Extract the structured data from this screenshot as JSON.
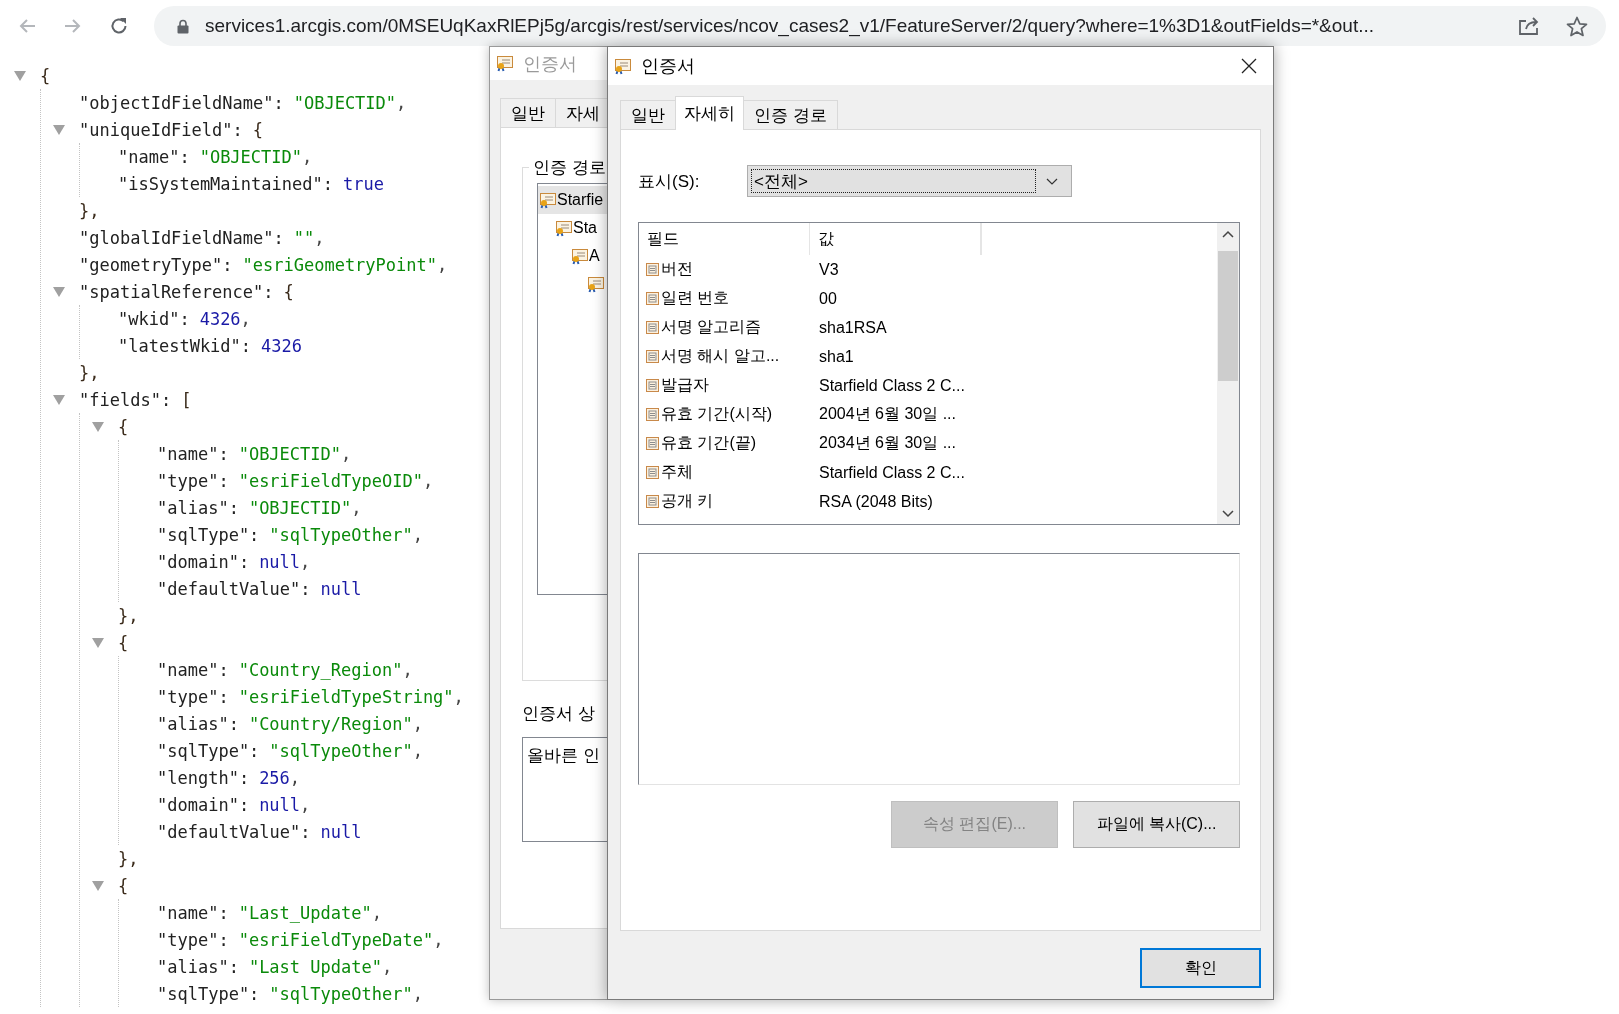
{
  "browser": {
    "nav": [
      {
        "kind": "back",
        "disabled": true
      },
      {
        "kind": "forward",
        "disabled": true
      },
      {
        "kind": "reload",
        "disabled": false
      }
    ],
    "url": "services1.arcgis.com/0MSEUqKaxRlEPj5g/arcgis/rest/services/ncov_cases2_v1/FeatureServer/2/query?where=1%3D1&outFields=*&out..."
  },
  "json_view": {
    "open": "{",
    "expanded": true,
    "children": [
      {
        "key": "\"objectIdFieldName\":",
        "value": "\"OBJECTID\"",
        "kind": "string",
        "end": ","
      },
      {
        "key": "\"uniqueIdField\":",
        "open": "{",
        "expanded": true,
        "close": "},",
        "children": [
          {
            "key": "\"name\":",
            "value": "\"OBJECTID\"",
            "kind": "string",
            "end": ","
          },
          {
            "key": "\"isSystemMaintained\":",
            "value": "true",
            "kind": "literal"
          }
        ]
      },
      {
        "key": "\"globalIdFieldName\":",
        "value": "\"\"",
        "kind": "string",
        "end": ","
      },
      {
        "key": "\"geometryType\":",
        "value": "\"esriGeometryPoint\"",
        "kind": "string",
        "end": ","
      },
      {
        "key": "\"spatialReference\":",
        "open": "{",
        "expanded": true,
        "close": "},",
        "children": [
          {
            "key": "\"wkid\":",
            "value": "4326",
            "kind": "number",
            "end": ","
          },
          {
            "key": "\"latestWkid\":",
            "value": "4326",
            "kind": "number"
          }
        ]
      },
      {
        "key": "\"fields\":",
        "open": "[",
        "expanded": true,
        "children": [
          {
            "open": "{",
            "expanded": true,
            "close": "},",
            "children": [
              {
                "key": "\"name\":",
                "value": "\"OBJECTID\"",
                "kind": "string",
                "end": ","
              },
              {
                "key": "\"type\":",
                "value": "\"esriFieldTypeOID\"",
                "kind": "string",
                "end": ","
              },
              {
                "key": "\"alias\":",
                "value": "\"OBJECTID\"",
                "kind": "string",
                "end": ","
              },
              {
                "key": "\"sqlType\":",
                "value": "\"sqlTypeOther\"",
                "kind": "string",
                "end": ","
              },
              {
                "key": "\"domain\":",
                "value": "null",
                "kind": "literal",
                "end": ","
              },
              {
                "key": "\"defaultValue\":",
                "value": "null",
                "kind": "literal"
              }
            ]
          },
          {
            "open": "{",
            "expanded": true,
            "close": "},",
            "children": [
              {
                "key": "\"name\":",
                "value": "\"Country_Region\"",
                "kind": "string",
                "end": ","
              },
              {
                "key": "\"type\":",
                "value": "\"esriFieldTypeString\"",
                "kind": "string",
                "end": ","
              },
              {
                "key": "\"alias\":",
                "value": "\"Country/Region\"",
                "kind": "string",
                "end": ","
              },
              {
                "key": "\"sqlType\":",
                "value": "\"sqlTypeOther\"",
                "kind": "string",
                "end": ","
              },
              {
                "key": "\"length\":",
                "value": "256",
                "kind": "number",
                "end": ","
              },
              {
                "key": "\"domain\":",
                "value": "null",
                "kind": "literal",
                "end": ","
              },
              {
                "key": "\"defaultValue\":",
                "value": "null",
                "kind": "literal"
              }
            ]
          },
          {
            "open": "{",
            "expanded": true,
            "children": [
              {
                "key": "\"name\":",
                "value": "\"Last_Update\"",
                "kind": "string",
                "end": ","
              },
              {
                "key": "\"type\":",
                "value": "\"esriFieldTypeDate\"",
                "kind": "string",
                "end": ","
              },
              {
                "key": "\"alias\":",
                "value": "\"Last Update\"",
                "kind": "string",
                "end": ","
              },
              {
                "key": "\"sqlType\":",
                "value": "\"sqlTypeOther\"",
                "kind": "string",
                "end": ","
              }
            ]
          }
        ]
      }
    ]
  },
  "back_dialog": {
    "title": "인증서",
    "active": false,
    "tabs": [
      {
        "label": "일반",
        "selected": false
      },
      {
        "label": "자세",
        "selected": false
      }
    ],
    "group_label": "인증 경로",
    "tree": [
      {
        "label": "Starfie",
        "selected": true,
        "children": [
          {
            "label": "Sta",
            "selected": false,
            "children": [
              {
                "label": "A",
                "selected": false,
                "children": [
                  {
                    "selected": false
                  }
                ]
              }
            ]
          }
        ]
      }
    ],
    "status_label": "인증서 상",
    "status_text": "올바른 인"
  },
  "front_dialog": {
    "title": "인증서",
    "active": true,
    "tabs": [
      {
        "label": "일반",
        "selected": false
      },
      {
        "label": "자세히",
        "selected": true
      },
      {
        "label": "인증 경로",
        "selected": false
      }
    ],
    "show_label": "표시(S):",
    "show_value": "<전체>",
    "columns": [
      "필드",
      "값"
    ],
    "rows": [
      {
        "field": "버전",
        "value": "V3"
      },
      {
        "field": "일련 번호",
        "value": "00"
      },
      {
        "field": "서명 알고리즘",
        "value": "sha1RSA"
      },
      {
        "field": "서명 해시 알고...",
        "value": "sha1"
      },
      {
        "field": "발급자",
        "value": "Starfield Class 2 C..."
      },
      {
        "field": "유효 기간(시작)",
        "value": "2004년 6월 30일 ..."
      },
      {
        "field": "유효 기간(끝)",
        "value": "2034년 6월 30일 ..."
      },
      {
        "field": "주체",
        "value": "Starfield Class 2 C..."
      },
      {
        "field": "공개 키",
        "value": "RSA (2048 Bits)"
      }
    ],
    "buttons": [
      {
        "label": "속성 편집(E)...",
        "disabled": true
      },
      {
        "label": "파일에 복사(C)...",
        "disabled": false
      }
    ],
    "ok_button": {
      "label": "확인",
      "default": true
    }
  }
}
